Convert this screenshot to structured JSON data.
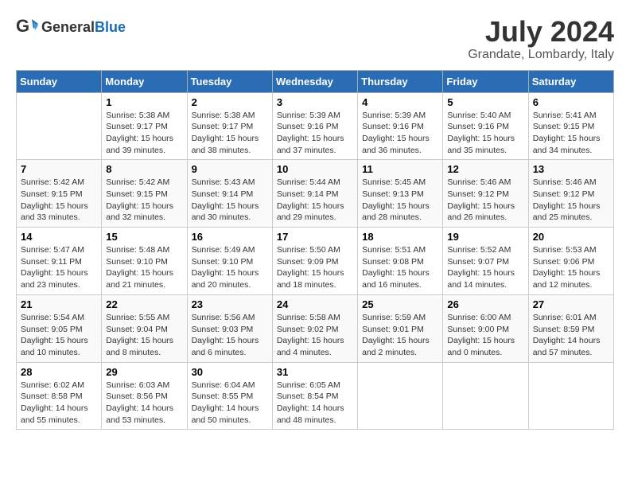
{
  "logo": {
    "general": "General",
    "blue": "Blue"
  },
  "title": {
    "month": "July 2024",
    "location": "Grandate, Lombardy, Italy"
  },
  "headers": [
    "Sunday",
    "Monday",
    "Tuesday",
    "Wednesday",
    "Thursday",
    "Friday",
    "Saturday"
  ],
  "weeks": [
    [
      {
        "day": "",
        "sunrise": "",
        "sunset": "",
        "daylight": ""
      },
      {
        "day": "1",
        "sunrise": "Sunrise: 5:38 AM",
        "sunset": "Sunset: 9:17 PM",
        "daylight": "Daylight: 15 hours and 39 minutes."
      },
      {
        "day": "2",
        "sunrise": "Sunrise: 5:38 AM",
        "sunset": "Sunset: 9:17 PM",
        "daylight": "Daylight: 15 hours and 38 minutes."
      },
      {
        "day": "3",
        "sunrise": "Sunrise: 5:39 AM",
        "sunset": "Sunset: 9:16 PM",
        "daylight": "Daylight: 15 hours and 37 minutes."
      },
      {
        "day": "4",
        "sunrise": "Sunrise: 5:39 AM",
        "sunset": "Sunset: 9:16 PM",
        "daylight": "Daylight: 15 hours and 36 minutes."
      },
      {
        "day": "5",
        "sunrise": "Sunrise: 5:40 AM",
        "sunset": "Sunset: 9:16 PM",
        "daylight": "Daylight: 15 hours and 35 minutes."
      },
      {
        "day": "6",
        "sunrise": "Sunrise: 5:41 AM",
        "sunset": "Sunset: 9:15 PM",
        "daylight": "Daylight: 15 hours and 34 minutes."
      }
    ],
    [
      {
        "day": "7",
        "sunrise": "Sunrise: 5:42 AM",
        "sunset": "Sunset: 9:15 PM",
        "daylight": "Daylight: 15 hours and 33 minutes."
      },
      {
        "day": "8",
        "sunrise": "Sunrise: 5:42 AM",
        "sunset": "Sunset: 9:15 PM",
        "daylight": "Daylight: 15 hours and 32 minutes."
      },
      {
        "day": "9",
        "sunrise": "Sunrise: 5:43 AM",
        "sunset": "Sunset: 9:14 PM",
        "daylight": "Daylight: 15 hours and 30 minutes."
      },
      {
        "day": "10",
        "sunrise": "Sunrise: 5:44 AM",
        "sunset": "Sunset: 9:14 PM",
        "daylight": "Daylight: 15 hours and 29 minutes."
      },
      {
        "day": "11",
        "sunrise": "Sunrise: 5:45 AM",
        "sunset": "Sunset: 9:13 PM",
        "daylight": "Daylight: 15 hours and 28 minutes."
      },
      {
        "day": "12",
        "sunrise": "Sunrise: 5:46 AM",
        "sunset": "Sunset: 9:12 PM",
        "daylight": "Daylight: 15 hours and 26 minutes."
      },
      {
        "day": "13",
        "sunrise": "Sunrise: 5:46 AM",
        "sunset": "Sunset: 9:12 PM",
        "daylight": "Daylight: 15 hours and 25 minutes."
      }
    ],
    [
      {
        "day": "14",
        "sunrise": "Sunrise: 5:47 AM",
        "sunset": "Sunset: 9:11 PM",
        "daylight": "Daylight: 15 hours and 23 minutes."
      },
      {
        "day": "15",
        "sunrise": "Sunrise: 5:48 AM",
        "sunset": "Sunset: 9:10 PM",
        "daylight": "Daylight: 15 hours and 21 minutes."
      },
      {
        "day": "16",
        "sunrise": "Sunrise: 5:49 AM",
        "sunset": "Sunset: 9:10 PM",
        "daylight": "Daylight: 15 hours and 20 minutes."
      },
      {
        "day": "17",
        "sunrise": "Sunrise: 5:50 AM",
        "sunset": "Sunset: 9:09 PM",
        "daylight": "Daylight: 15 hours and 18 minutes."
      },
      {
        "day": "18",
        "sunrise": "Sunrise: 5:51 AM",
        "sunset": "Sunset: 9:08 PM",
        "daylight": "Daylight: 15 hours and 16 minutes."
      },
      {
        "day": "19",
        "sunrise": "Sunrise: 5:52 AM",
        "sunset": "Sunset: 9:07 PM",
        "daylight": "Daylight: 15 hours and 14 minutes."
      },
      {
        "day": "20",
        "sunrise": "Sunrise: 5:53 AM",
        "sunset": "Sunset: 9:06 PM",
        "daylight": "Daylight: 15 hours and 12 minutes."
      }
    ],
    [
      {
        "day": "21",
        "sunrise": "Sunrise: 5:54 AM",
        "sunset": "Sunset: 9:05 PM",
        "daylight": "Daylight: 15 hours and 10 minutes."
      },
      {
        "day": "22",
        "sunrise": "Sunrise: 5:55 AM",
        "sunset": "Sunset: 9:04 PM",
        "daylight": "Daylight: 15 hours and 8 minutes."
      },
      {
        "day": "23",
        "sunrise": "Sunrise: 5:56 AM",
        "sunset": "Sunset: 9:03 PM",
        "daylight": "Daylight: 15 hours and 6 minutes."
      },
      {
        "day": "24",
        "sunrise": "Sunrise: 5:58 AM",
        "sunset": "Sunset: 9:02 PM",
        "daylight": "Daylight: 15 hours and 4 minutes."
      },
      {
        "day": "25",
        "sunrise": "Sunrise: 5:59 AM",
        "sunset": "Sunset: 9:01 PM",
        "daylight": "Daylight: 15 hours and 2 minutes."
      },
      {
        "day": "26",
        "sunrise": "Sunrise: 6:00 AM",
        "sunset": "Sunset: 9:00 PM",
        "daylight": "Daylight: 15 hours and 0 minutes."
      },
      {
        "day": "27",
        "sunrise": "Sunrise: 6:01 AM",
        "sunset": "Sunset: 8:59 PM",
        "daylight": "Daylight: 14 hours and 57 minutes."
      }
    ],
    [
      {
        "day": "28",
        "sunrise": "Sunrise: 6:02 AM",
        "sunset": "Sunset: 8:58 PM",
        "daylight": "Daylight: 14 hours and 55 minutes."
      },
      {
        "day": "29",
        "sunrise": "Sunrise: 6:03 AM",
        "sunset": "Sunset: 8:56 PM",
        "daylight": "Daylight: 14 hours and 53 minutes."
      },
      {
        "day": "30",
        "sunrise": "Sunrise: 6:04 AM",
        "sunset": "Sunset: 8:55 PM",
        "daylight": "Daylight: 14 hours and 50 minutes."
      },
      {
        "day": "31",
        "sunrise": "Sunrise: 6:05 AM",
        "sunset": "Sunset: 8:54 PM",
        "daylight": "Daylight: 14 hours and 48 minutes."
      },
      {
        "day": "",
        "sunrise": "",
        "sunset": "",
        "daylight": ""
      },
      {
        "day": "",
        "sunrise": "",
        "sunset": "",
        "daylight": ""
      },
      {
        "day": "",
        "sunrise": "",
        "sunset": "",
        "daylight": ""
      }
    ]
  ]
}
